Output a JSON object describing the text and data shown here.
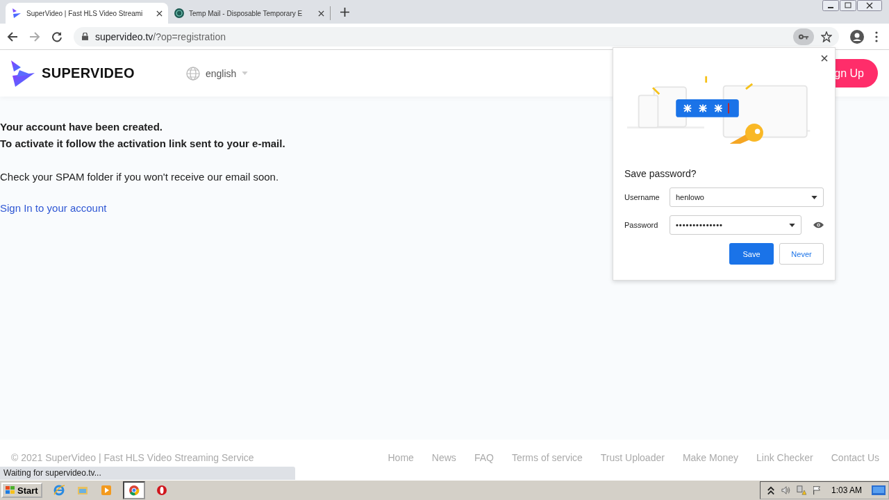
{
  "browser": {
    "tabs": [
      {
        "title": "SuperVideo | Fast HLS Video Streami",
        "selected": true
      },
      {
        "title": "Temp Mail - Disposable Temporary E",
        "selected": false
      }
    ],
    "url_host": "supervideo.tv",
    "url_path": "/?op=registration",
    "key_icon_active": true
  },
  "header": {
    "brand": "SUPERVIDEO",
    "language": "english",
    "signup_visible_text": "gn Up"
  },
  "message": {
    "lines": [
      "Your account have been created.",
      "To activate it follow the activation link sent to your e-mail."
    ],
    "note": "Check your SPAM folder if you won't receive our email soon.",
    "link": "Sign In to your account"
  },
  "password_popup": {
    "title": "Save password?",
    "username_label": "Username",
    "username": "henlowo",
    "password_label": "Password",
    "password": "••••••••••••••",
    "save": "Save",
    "never": "Never"
  },
  "footer": {
    "copyright": "© 2021 SuperVideo | Fast HLS Video Streaming Service",
    "links": [
      "Home",
      "News",
      "FAQ",
      "Terms of service",
      "Trust Uploader",
      "Make Money",
      "Link Checker",
      "Contact Us"
    ]
  },
  "status_bubble": "Waiting for supervideo.tv...",
  "taskbar": {
    "start": "Start",
    "apps": [
      {
        "kind": "ie",
        "selected": false
      },
      {
        "kind": "folder",
        "selected": false
      },
      {
        "kind": "media",
        "selected": false
      },
      {
        "kind": "chrome",
        "selected": true
      },
      {
        "kind": "opera",
        "selected": false
      }
    ],
    "clock": "1:03 AM"
  }
}
